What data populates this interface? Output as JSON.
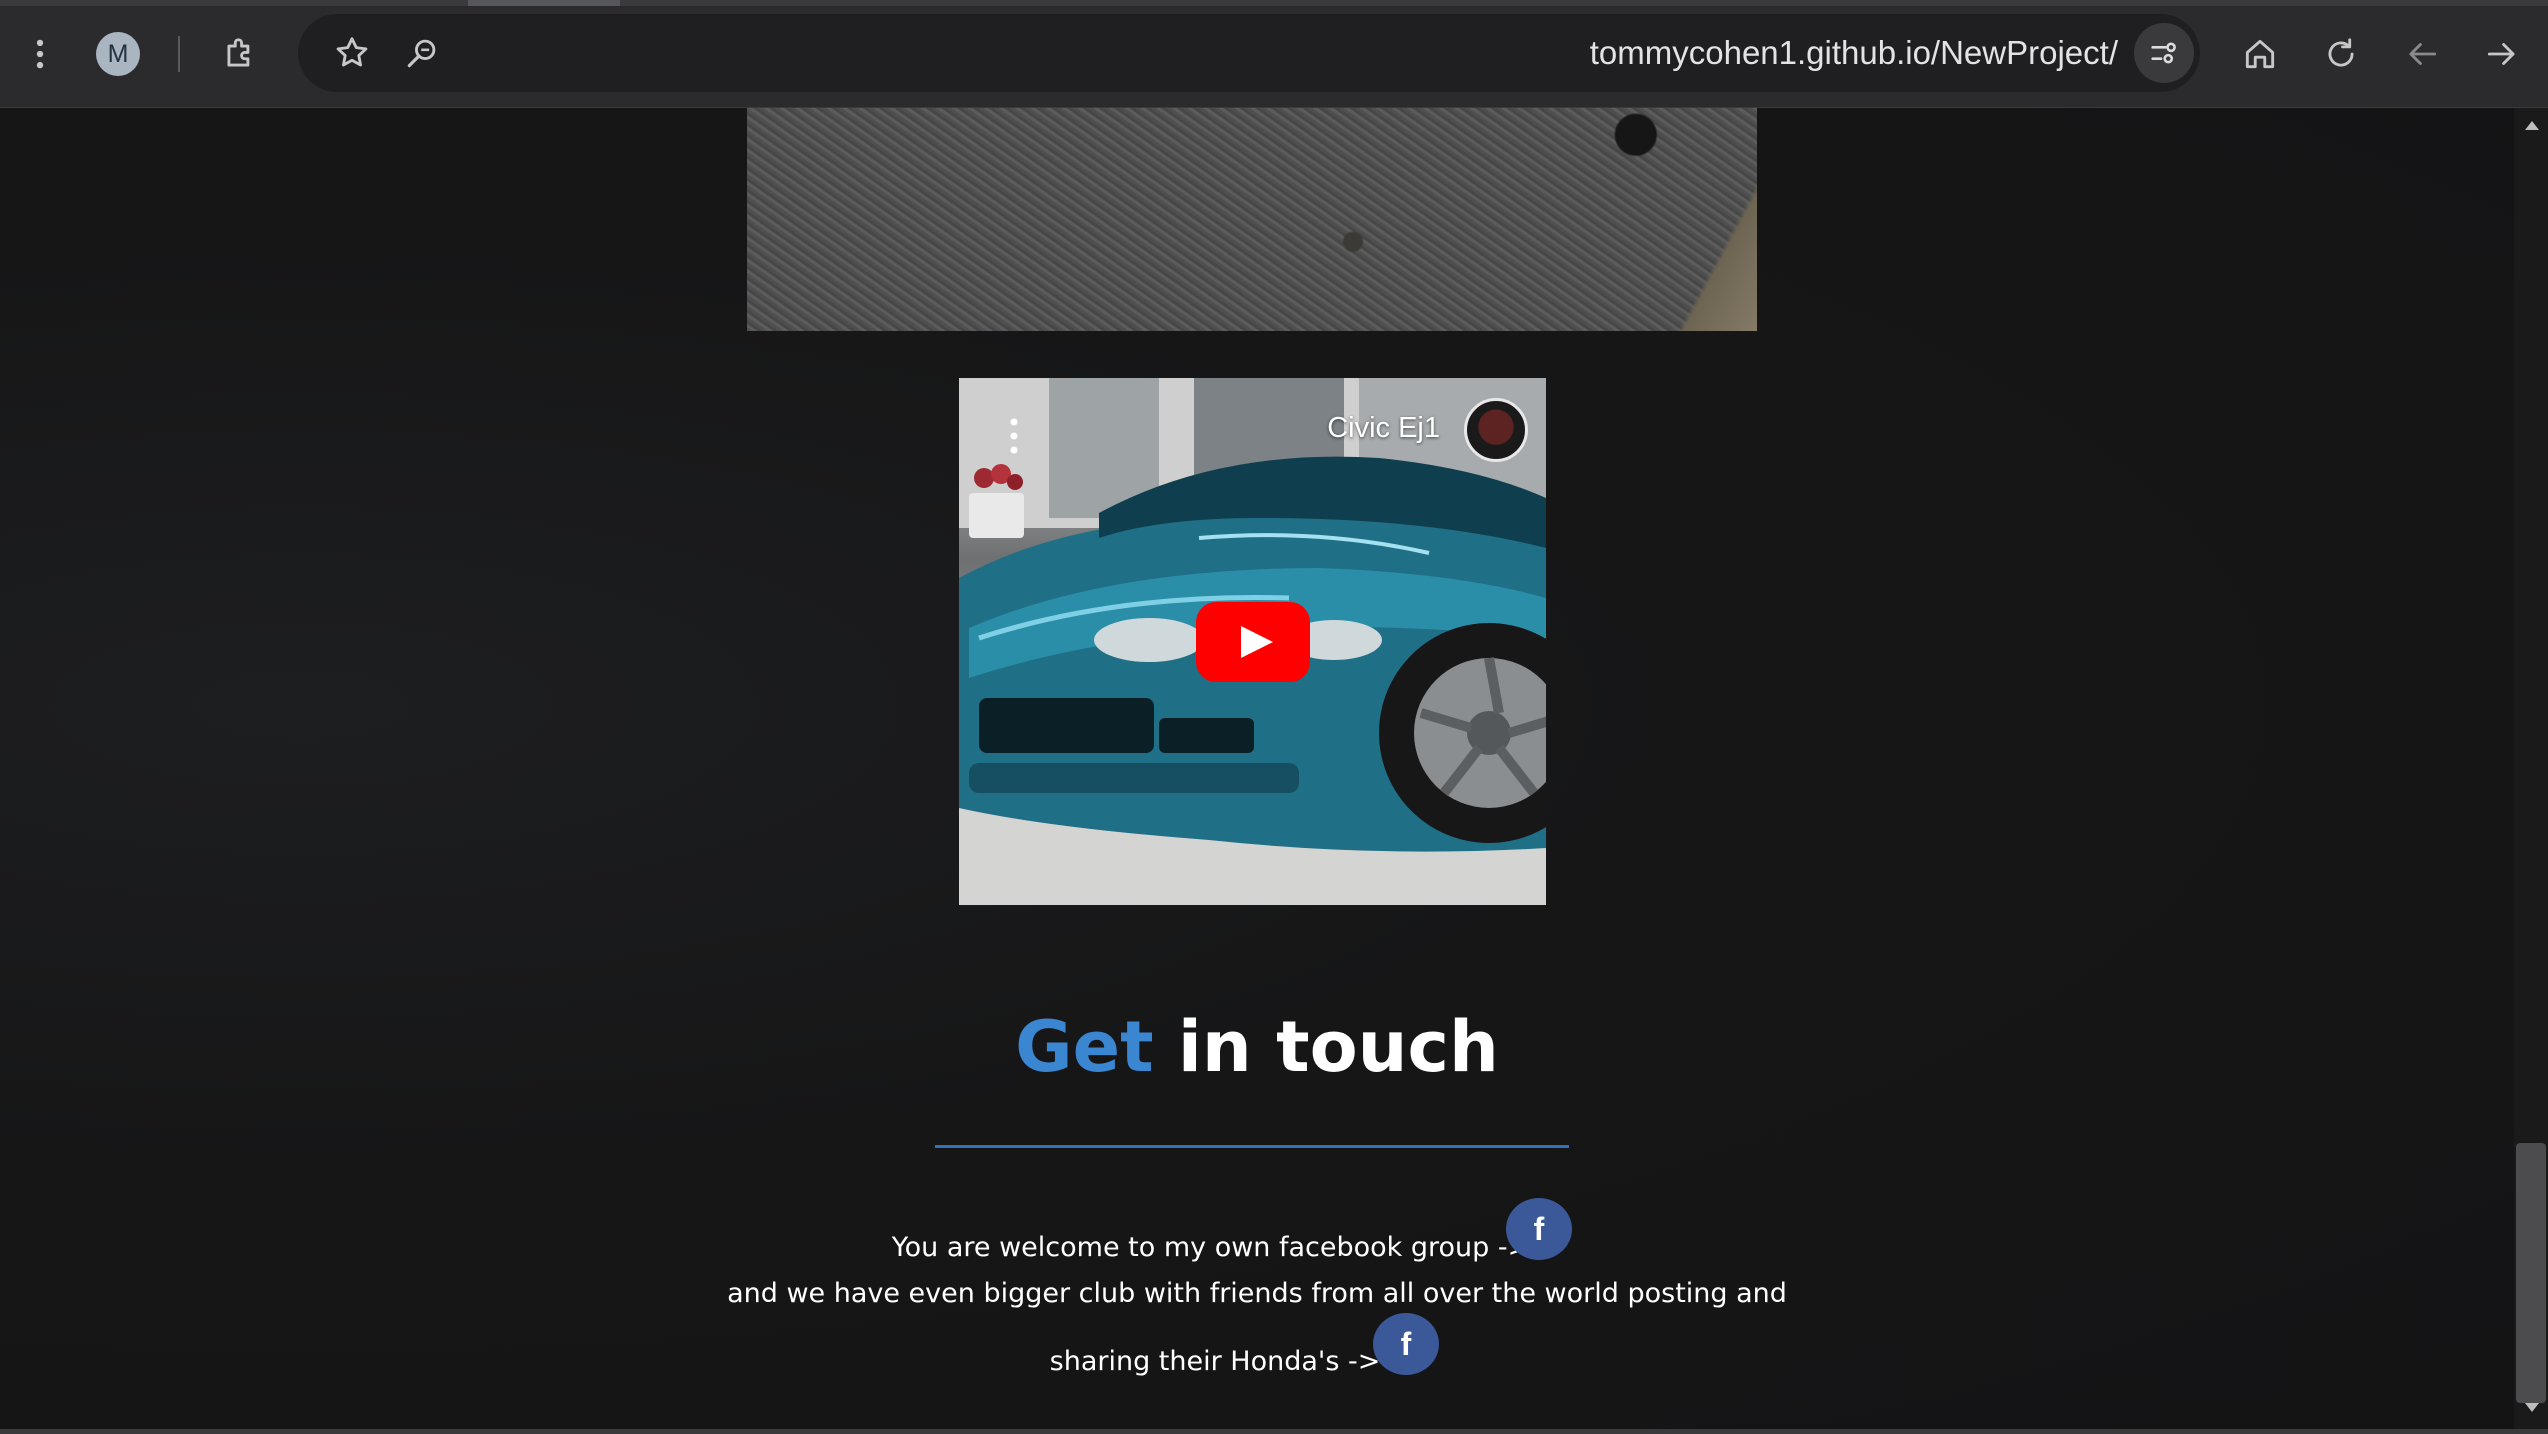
{
  "browser": {
    "avatar_initial": "M",
    "url": "tommycohen1.github.io/NewProject/",
    "icons": [
      "kebab-menu-icon",
      "extensions-icon",
      "bookmark-star-icon",
      "zoom-icon",
      "site-settings-icon",
      "home-icon",
      "reload-icon",
      "back-arrow-icon",
      "forward-arrow-icon"
    ]
  },
  "video": {
    "title": "Civic Ej1",
    "play_color": "#ff0000"
  },
  "contact": {
    "title_accent": "Get",
    "title_rest": "in touch",
    "accent_color": "#3a86d1",
    "line1": "You are welcome to my own facebook group ->",
    "line2": "and we have even bigger club with friends from all over the world posting and",
    "line3": "sharing their Honda's ->",
    "facebook_glyph": "f",
    "facebook_color": "#3b5998"
  }
}
